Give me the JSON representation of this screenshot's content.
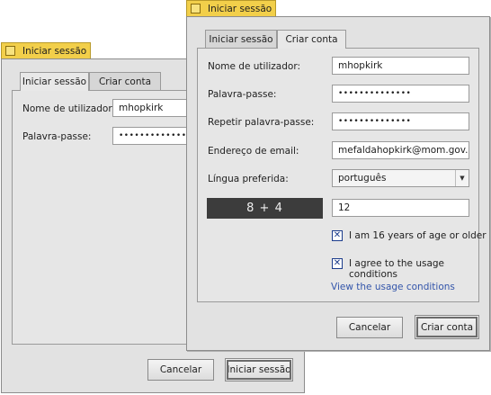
{
  "back_window": {
    "title": "Iniciar sessão",
    "tabs": [
      {
        "label": "Iniciar sessão"
      },
      {
        "label": "Criar conta"
      }
    ],
    "username_label": "Nome de utilizador:",
    "username_value": "mhopkirk",
    "password_label": "Palavra-passe:",
    "password_value": "••••••••••••••",
    "cancel_label": "Cancelar",
    "login_label": "Iniciar sessão"
  },
  "front_window": {
    "title": "Iniciar sessão",
    "tabs": [
      {
        "label": "Iniciar sessão"
      },
      {
        "label": "Criar conta"
      }
    ],
    "username_label": "Nome de utilizador:",
    "username_value": "mhopkirk",
    "password_label": "Palavra-passe:",
    "password_value": "••••••••••••••",
    "repeat_password_label": "Repetir palavra-passe:",
    "repeat_password_value": "••••••••••••••",
    "email_label": "Endereço de email:",
    "email_value": "mefaldahopkirk@mom.gov.uk",
    "language_label": "Língua preferida:",
    "language_value": "português",
    "captcha_text": "8 + 4",
    "captcha_answer": "12",
    "age_check_label": "I am 16 years of age or older",
    "age_checked": true,
    "terms_check_label": "I agree to the usage conditions",
    "terms_checked": true,
    "view_conditions_link": "View the usage conditions",
    "cancel_label": "Cancelar",
    "create_label": "Criar conta"
  },
  "colors": {
    "title_tab": "#f2cf4a",
    "window_bg": "#e2e2e2",
    "captcha_bg": "#3c3c3c",
    "link": "#3355aa"
  }
}
